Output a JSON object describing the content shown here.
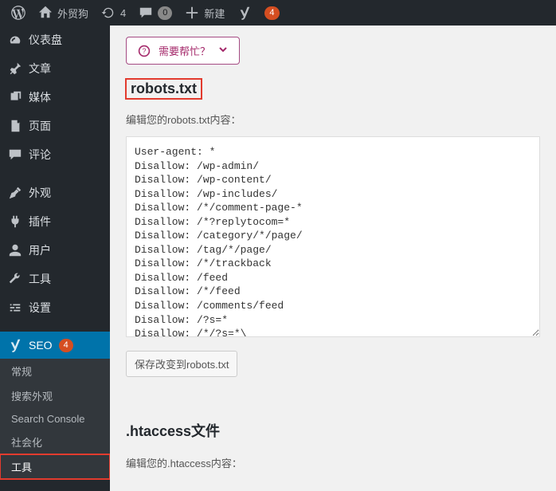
{
  "adminbar": {
    "site_name": "外贸狗",
    "updates_count": "4",
    "comments_count": "0",
    "new_label": "新建",
    "alert_count": "4"
  },
  "sidebar": {
    "items": {
      "dashboard": "仪表盘",
      "posts": "文章",
      "media": "媒体",
      "pages": "页面",
      "comments": "评论",
      "appearance": "外观",
      "plugins": "插件",
      "users": "用户",
      "tools": "工具",
      "settings": "设置",
      "seo": "SEO",
      "seo_badge": "4"
    },
    "sub": {
      "general": "常规",
      "search_appearance": "搜索外观",
      "search_console": "Search Console",
      "social": "社会化",
      "tools": "工具"
    }
  },
  "content": {
    "help_label": "需要帮忙？",
    "robots_heading": "robots.txt",
    "robots_desc": "编辑您的robots.txt内容：",
    "robots_content": "User-agent: *\nDisallow: /wp-admin/\nDisallow: /wp-content/\nDisallow: /wp-includes/\nDisallow: /*/comment-page-*\nDisallow: /*?replytocom=*\nDisallow: /category/*/page/\nDisallow: /tag/*/page/\nDisallow: /*/trackback\nDisallow: /feed\nDisallow: /*/feed\nDisallow: /comments/feed\nDisallow: /?s=*\nDisallow: /*/?s=*\\\nDisallow: /attachment/",
    "save_robots": "保存改变到robots.txt",
    "htaccess_heading": ".htaccess文件",
    "htaccess_desc": "编辑您的.htaccess内容："
  }
}
